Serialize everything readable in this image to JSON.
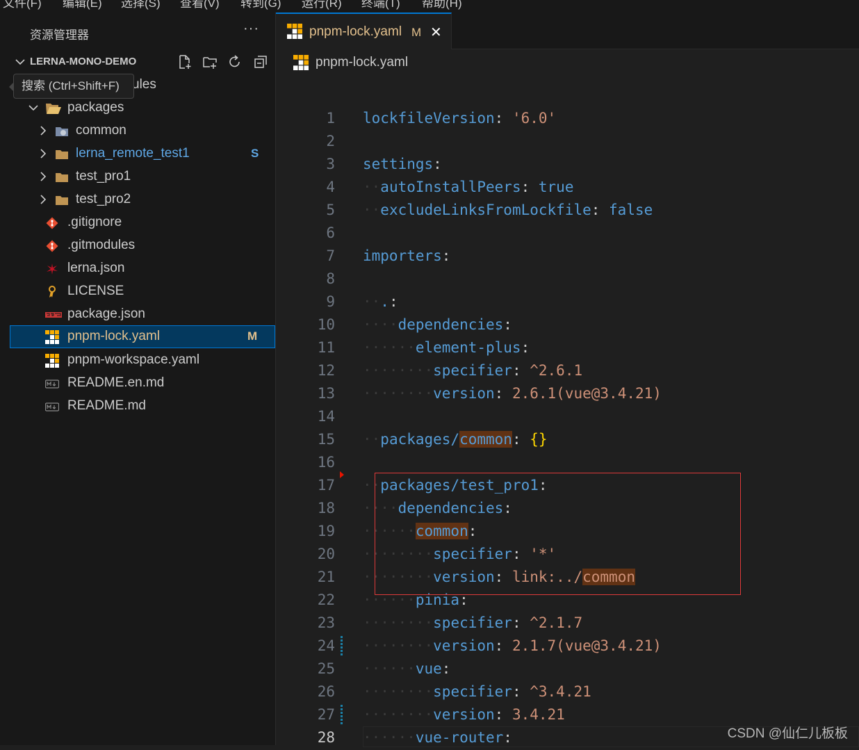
{
  "menu": [
    "文件(F)",
    "编辑(E)",
    "选择(S)",
    "查看(V)",
    "转到(G)",
    "运行(R)",
    "终端(T)",
    "帮助(H)"
  ],
  "sidebar": {
    "title": "资源管理器",
    "more": "···",
    "section": "LERNA-MONO-DEMO",
    "tooltip": "搜索 (Ctrl+Shift+F)",
    "hidden_row_tail": "ules",
    "items": [
      {
        "label": "packages",
        "icon": "folder-open-icon",
        "badge": ""
      },
      {
        "label": "common",
        "icon": "folder-icon",
        "badge": ""
      },
      {
        "label": "lerna_remote_test1",
        "icon": "folder-icon",
        "badge": "S"
      },
      {
        "label": "test_pro1",
        "icon": "folder-icon",
        "badge": ""
      },
      {
        "label": "test_pro2",
        "icon": "folder-icon",
        "badge": ""
      },
      {
        "label": ".gitignore",
        "icon": "git-icon",
        "badge": ""
      },
      {
        "label": ".gitmodules",
        "icon": "git-icon",
        "badge": ""
      },
      {
        "label": "lerna.json",
        "icon": "lerna-icon",
        "badge": ""
      },
      {
        "label": "LICENSE",
        "icon": "license-icon",
        "badge": ""
      },
      {
        "label": "package.json",
        "icon": "npm-icon",
        "badge": ""
      },
      {
        "label": "pnpm-lock.yaml",
        "icon": "pnpm-icon",
        "badge": "M"
      },
      {
        "label": "pnpm-workspace.yaml",
        "icon": "pnpm-icon",
        "badge": ""
      },
      {
        "label": "README.en.md",
        "icon": "markdown-icon",
        "badge": ""
      },
      {
        "label": "README.md",
        "icon": "markdown-icon",
        "badge": ""
      }
    ]
  },
  "colors": {
    "accent": "#0078d4",
    "modified": "#e2c08d",
    "untracked": "#73c991",
    "highlight_box": "#e03a3a"
  },
  "editor": {
    "tab": {
      "label": "pnpm-lock.yaml",
      "badge": "M",
      "close": "✕"
    },
    "breadcrumb": "pnpm-lock.yaml",
    "lines": [
      {
        "n": "1",
        "t": "lockfileVersion: '6.0'"
      },
      {
        "n": "2",
        "t": ""
      },
      {
        "n": "3",
        "t": "settings:"
      },
      {
        "n": "4",
        "t": "  autoInstallPeers: true"
      },
      {
        "n": "5",
        "t": "  excludeLinksFromLockfile: false"
      },
      {
        "n": "6",
        "t": ""
      },
      {
        "n": "7",
        "t": "importers:"
      },
      {
        "n": "8",
        "t": ""
      },
      {
        "n": "9",
        "t": "  .:"
      },
      {
        "n": "10",
        "t": "    dependencies:"
      },
      {
        "n": "11",
        "t": "      element-plus:"
      },
      {
        "n": "12",
        "t": "        specifier: ^2.6.1"
      },
      {
        "n": "13",
        "t": "        version: 2.6.1(vue@3.4.21)"
      },
      {
        "n": "14",
        "t": ""
      },
      {
        "n": "15",
        "t": "  packages/common: {}"
      },
      {
        "n": "16",
        "t": ""
      },
      {
        "n": "17",
        "t": "  packages/test_pro1:"
      },
      {
        "n": "18",
        "t": "    dependencies:"
      },
      {
        "n": "19",
        "t": "      common:"
      },
      {
        "n": "20",
        "t": "        specifier: '*'"
      },
      {
        "n": "21",
        "t": "        version: link:../common"
      },
      {
        "n": "22",
        "t": "      pinia:"
      },
      {
        "n": "23",
        "t": "        specifier: ^2.1.7"
      },
      {
        "n": "24",
        "t": "        version: 2.1.7(vue@3.4.21)"
      },
      {
        "n": "25",
        "t": "      vue:"
      },
      {
        "n": "26",
        "t": "        specifier: ^3.4.21"
      },
      {
        "n": "27",
        "t": "        version: 3.4.21"
      },
      {
        "n": "28",
        "t": "      vue-router:"
      }
    ]
  },
  "watermark": "CSDN @仙仁儿板板"
}
